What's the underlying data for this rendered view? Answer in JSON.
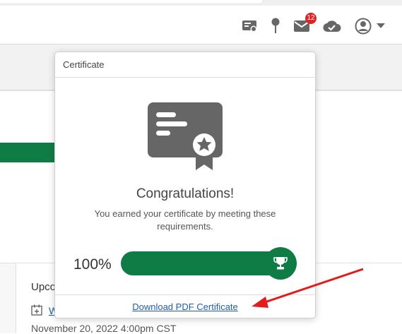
{
  "header": {
    "icons": [
      "certificate-icon",
      "pin-icon",
      "mail-icon",
      "cloud-check-icon",
      "user-avatar-icon",
      "caret-down-icon"
    ],
    "mail_badge": "12"
  },
  "background": {
    "upcoming_partial": "Upco",
    "event_link_partial": "W",
    "event_date": "November 20, 2022 4:00pm CST",
    "accent_color": "#107c45"
  },
  "certificate_popover": {
    "title": "Certificate",
    "heading": "Congratulations!",
    "message": "You earned your certificate by meeting these requirements.",
    "progress_label": "100%",
    "progress_value": 1.0,
    "download_link": "Download PDF Certificate",
    "colors": {
      "progress": "#107c45",
      "icon": "#666666",
      "arrow": "#e31b1b"
    }
  }
}
